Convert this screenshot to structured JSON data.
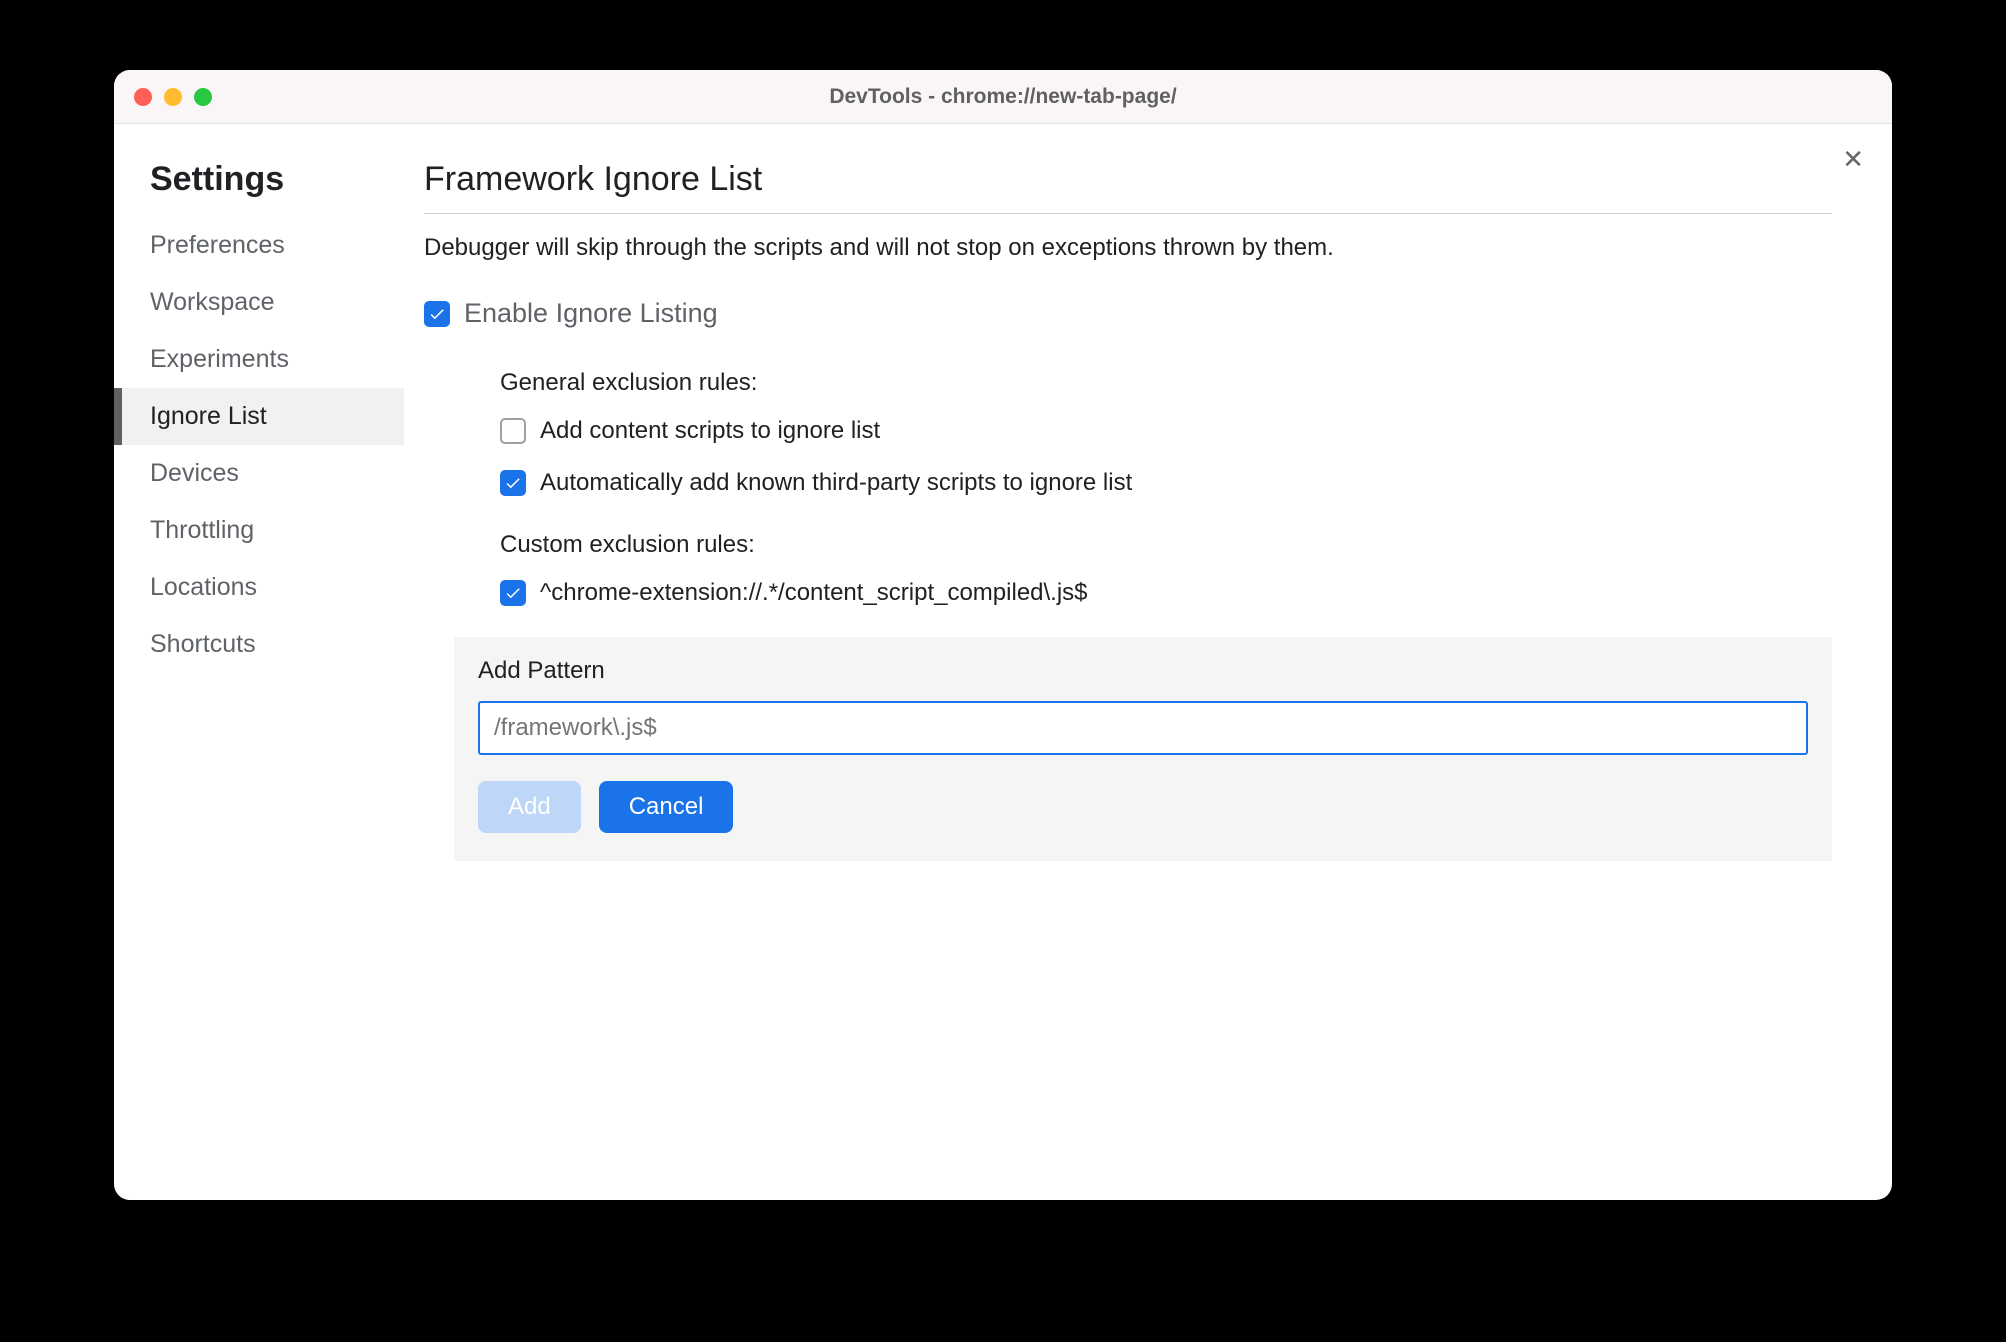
{
  "window": {
    "title": "DevTools - chrome://new-tab-page/"
  },
  "sidebar": {
    "header": "Settings",
    "items": [
      {
        "label": "Preferences",
        "active": false
      },
      {
        "label": "Workspace",
        "active": false
      },
      {
        "label": "Experiments",
        "active": false
      },
      {
        "label": "Ignore List",
        "active": true
      },
      {
        "label": "Devices",
        "active": false
      },
      {
        "label": "Throttling",
        "active": false
      },
      {
        "label": "Locations",
        "active": false
      },
      {
        "label": "Shortcuts",
        "active": false
      }
    ]
  },
  "main": {
    "title": "Framework Ignore List",
    "description": "Debugger will skip through the scripts and will not stop on exceptions thrown by them.",
    "enable_label": "Enable Ignore Listing",
    "enable_checked": true,
    "general_section_label": "General exclusion rules:",
    "general_rules": [
      {
        "label": "Add content scripts to ignore list",
        "checked": false
      },
      {
        "label": "Automatically add known third-party scripts to ignore list",
        "checked": true
      }
    ],
    "custom_section_label": "Custom exclusion rules:",
    "custom_rules": [
      {
        "label": "^chrome-extension://.*/content_script_compiled\\.js$",
        "checked": true
      }
    ],
    "add_pattern": {
      "label": "Add Pattern",
      "placeholder": "/framework\\.js$",
      "add_button": "Add",
      "cancel_button": "Cancel"
    }
  }
}
